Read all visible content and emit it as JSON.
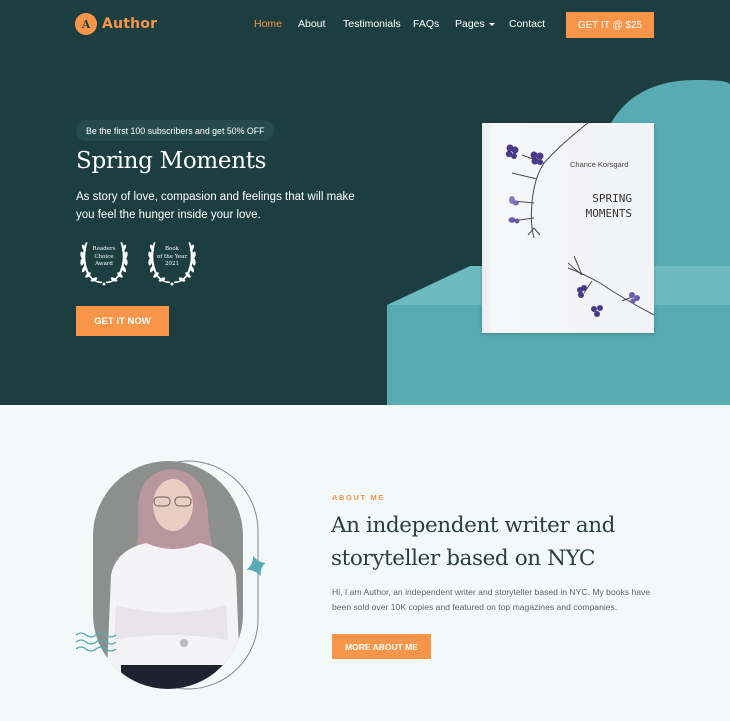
{
  "colors": {
    "hero_bg": "#1c3e40",
    "accent": "#f89548",
    "teal": "#58abb3",
    "light_bg": "#f3f9f9"
  },
  "header": {
    "logo_letter": "A",
    "logo_text": "Author",
    "nav": [
      {
        "label": "Home",
        "active": true
      },
      {
        "label": "About",
        "active": false
      },
      {
        "label": "Testimonials",
        "active": false
      },
      {
        "label": "FAQs",
        "active": false
      },
      {
        "label": "Pages",
        "active": false,
        "has_dropdown": true
      },
      {
        "label": "Contact",
        "active": false
      }
    ],
    "cta_label": "GET IT @ $25"
  },
  "hero": {
    "promo_badge": "Be the first 100 subscribers and get 50% OFF",
    "title": "Spring Moments",
    "description": "As story of love, compasion and feelings that will make you feel the hunger inside your love.",
    "awards": [
      {
        "lines": [
          "Readers",
          "Choice",
          "Award"
        ],
        "icon": "laurel-wreath-icon"
      },
      {
        "lines": [
          "Book",
          "of the Year",
          "2021"
        ],
        "icon": "laurel-wreath-icon"
      }
    ],
    "cta_label": "GET IT NOW",
    "book": {
      "author": "Chance Korsgard",
      "title_lines": [
        "SPRING",
        "MOMENTS"
      ]
    }
  },
  "about": {
    "label": "ABOUT ME",
    "title": "An independent writer and storyteller based on NYC",
    "description": "Hi, I am Author, an independent writer and storyteller based in NYC. My books have been sold over 10K copies and featured on top magazines and companies.",
    "cta_label": "MORE ABOUT ME",
    "decor_icons": [
      "sparkle-star-icon",
      "wave-lines-icon"
    ]
  }
}
